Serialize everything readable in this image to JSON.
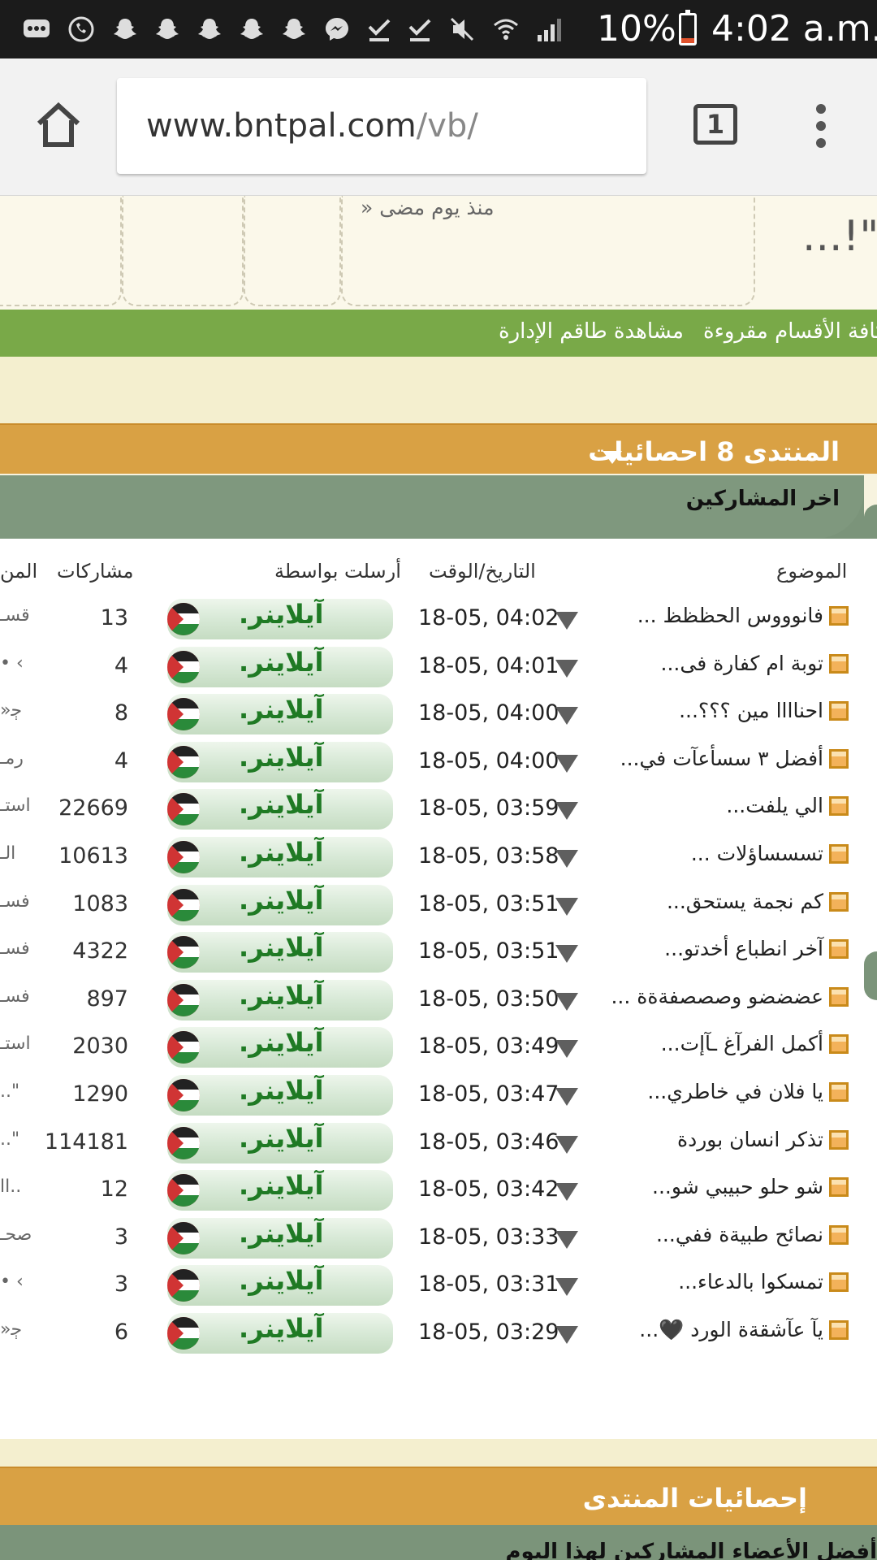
{
  "status_bar": {
    "icons": [
      "chat-bubble-icon",
      "whatsapp-icon",
      "snapchat-icon",
      "snapchat-icon",
      "snapchat-icon",
      "snapchat-icon",
      "snapchat-icon",
      "messenger-icon",
      "download-done-icon",
      "download-done-icon",
      "mute-icon",
      "wifi-icon",
      "signal-icon"
    ],
    "battery": "10%",
    "time": "4:02 a.m."
  },
  "browser": {
    "url_domain": "www.bntpal.com",
    "url_path": "/vb/",
    "tab_count": "1"
  },
  "page": {
    "top_ago": "منذ يوم مضى",
    "top_quote": "...!\"",
    "nav_links": [
      "كافة الأقسام مقروءة",
      "مشاهدة طاقم الإدارة"
    ],
    "forum_stats_title": "المنتدى 8 احصائيات",
    "latest_posters_caption": "اخر المشاركين",
    "columns": {
      "topic": "الموضوع",
      "datetime": "التاريخ/الوقت",
      "sent_by": "أرسلت بواسطة",
      "posts": "مشاركات",
      "forum_clip": "المن"
    },
    "rows": [
      {
        "topic": "فانوووس الحظظظ ...",
        "datetime": "18-05, 04:02",
        "user": "آيلاينر.",
        "posts": "13",
        "clip": "قسـ"
      },
      {
        "topic": "توبة ام كفارة فى...",
        "datetime": "18-05, 04:01",
        "user": "آيلاينر.",
        "posts": "4",
        "clip": "• ‹"
      },
      {
        "topic": "احناااا مين ؟؟؟...",
        "datetime": "18-05, 04:00",
        "user": "آيلاينر.",
        "posts": "8",
        "clip": "»ﭴ"
      },
      {
        "topic": "أفضل ٣ سسأعآت في...",
        "datetime": "18-05, 04:00",
        "user": "آيلاينر.",
        "posts": "4",
        "clip": "رمـ"
      },
      {
        "topic": "الي يلفت...",
        "datetime": "18-05, 03:59",
        "user": "آيلاينر.",
        "posts": "22669",
        "clip": "استـ"
      },
      {
        "topic": "تسسساؤلات ...",
        "datetime": "18-05, 03:58",
        "user": "آيلاينر.",
        "posts": "10613",
        "clip": "الـ"
      },
      {
        "topic": "كم نجمة يستحق...",
        "datetime": "18-05, 03:51",
        "user": "آيلاينر.",
        "posts": "1083",
        "clip": "فسـ"
      },
      {
        "topic": "آخر انطباع أخدتو...",
        "datetime": "18-05, 03:51",
        "user": "آيلاينر.",
        "posts": "4322",
        "clip": "فسـ"
      },
      {
        "topic": "عضضضو وصصصفةةة ...",
        "datetime": "18-05, 03:50",
        "user": "آيلاينر.",
        "posts": "897",
        "clip": "فسـ"
      },
      {
        "topic": "أكمل الفرآغ ـآإت...",
        "datetime": "18-05, 03:49",
        "user": "آيلاينر.",
        "posts": "2030",
        "clip": "استـ"
      },
      {
        "topic": "يا فلان في خاطري...",
        "datetime": "18-05, 03:47",
        "user": "آيلاينر.",
        "posts": "1290",
        "clip": "..\""
      },
      {
        "topic": "تذكر انسان بوردة",
        "datetime": "18-05, 03:46",
        "user": "آيلاينر.",
        "posts": "114181",
        "clip": "..\""
      },
      {
        "topic": "شو حلو حبيبي شو...",
        "datetime": "18-05, 03:42",
        "user": "آيلاينر.",
        "posts": "12",
        "clip": "اا.."
      },
      {
        "topic": "نصائح طبيةة ففي...",
        "datetime": "18-05, 03:33",
        "user": "آيلاينر.",
        "posts": "3",
        "clip": "صحـ"
      },
      {
        "topic": "تمسكوا بالدعاء...",
        "datetime": "18-05, 03:31",
        "user": "آيلاينر.",
        "posts": "3",
        "clip": "• ‹"
      },
      {
        "topic": "يآ عآشقةة الورد 🖤...",
        "datetime": "18-05, 03:29",
        "user": "آيلاينر.",
        "posts": "6",
        "clip": "»ﭴ"
      }
    ],
    "forum_statistics_title": "إحصائيات المنتدى",
    "best_members_caption": "أفضل الأعضاء المشاركين لهذا اليوم"
  }
}
